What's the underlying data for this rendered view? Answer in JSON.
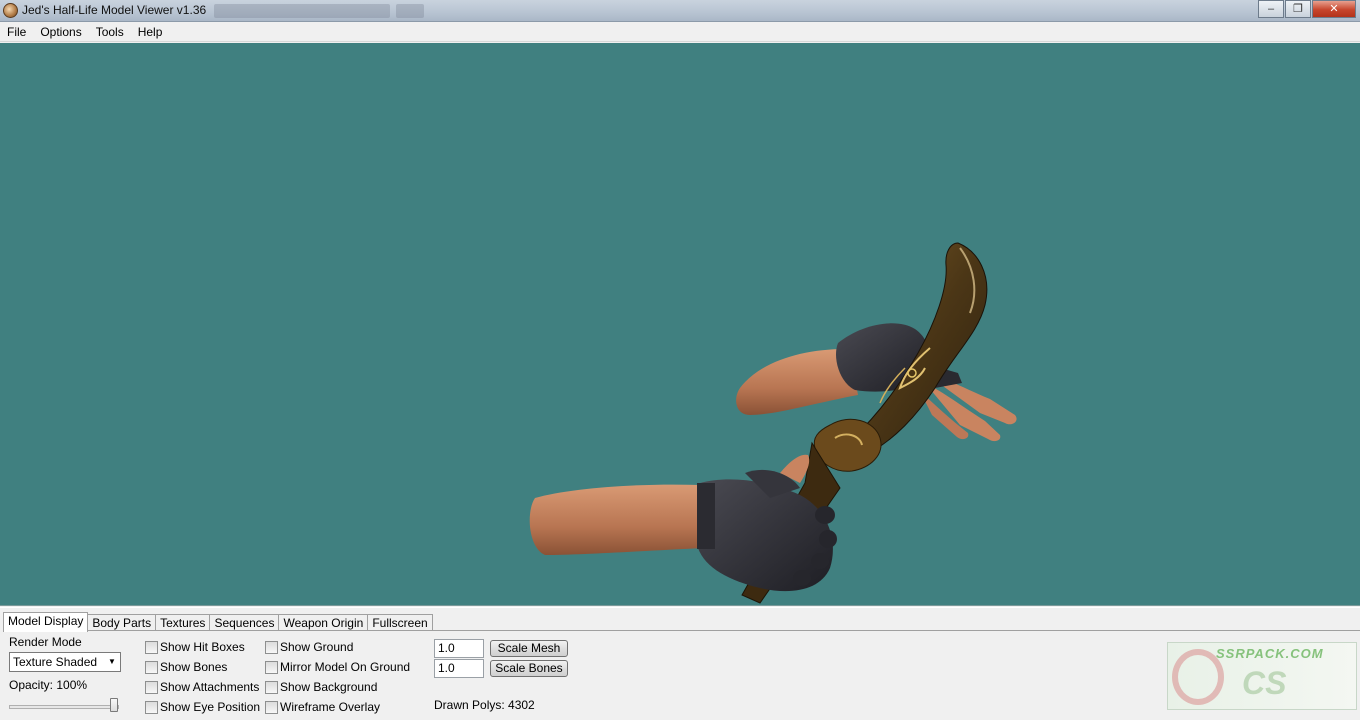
{
  "window": {
    "title": "Jed's Half-Life Model Viewer v1.36"
  },
  "menu": [
    "File",
    "Options",
    "Tools",
    "Help"
  ],
  "viewport": {
    "background": "#408080"
  },
  "tabs": [
    "Model Display",
    "Body Parts",
    "Textures",
    "Sequences",
    "Weapon Origin",
    "Fullscreen"
  ],
  "model_display": {
    "render_mode_label": "Render Mode",
    "render_mode_value": "Texture Shaded",
    "opacity_label": "Opacity: 100%",
    "opacity": 1.0,
    "checkboxes_col1": [
      "Show Hit Boxes",
      "Show Bones",
      "Show Attachments",
      "Show Eye Position"
    ],
    "checkboxes_col2": [
      "Show Ground",
      "Mirror Model On Ground",
      "Show Background",
      "Wireframe Overlay"
    ],
    "scale_mesh_value": "1.0",
    "scale_bones_value": "1.0",
    "scale_mesh_button": "Scale Mesh",
    "scale_bones_button": "Scale Bones",
    "drawn_polys": "Drawn Polys: 4302"
  },
  "watermark": {
    "top": "SSRPACK.COM",
    "main": "CS"
  }
}
